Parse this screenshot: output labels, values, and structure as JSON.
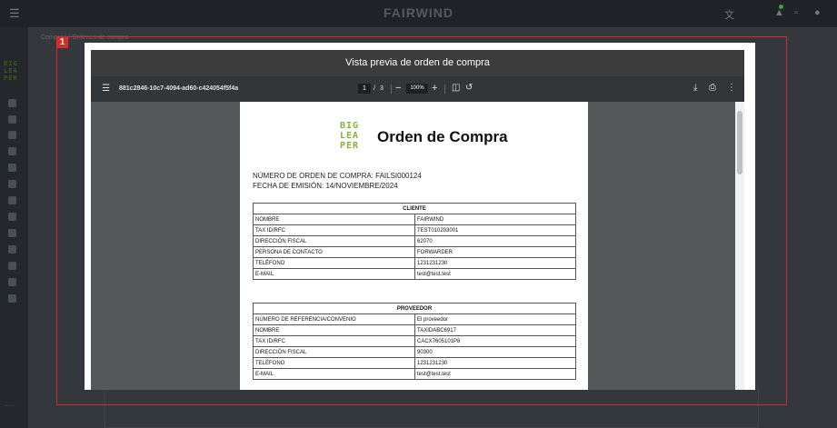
{
  "app": {
    "brand": "FAIRWIND",
    "breadcrumb": "Compras  /  Ordenes de compra"
  },
  "sidebar": {
    "logo": [
      "BIG",
      "LEA",
      "PER"
    ]
  },
  "highlight": {
    "label": "1"
  },
  "modal": {
    "title": "Vista previa de orden de compra"
  },
  "viewer": {
    "filename": "881c2846-10c7-4094-ad60-c424054f5f4a",
    "current_page": "1",
    "page_sep": "/",
    "total_pages": "3",
    "zoom": "100%",
    "icons": [
      "menu-icon",
      "zoom-out-icon",
      "zoom-in-icon",
      "fit-page-icon",
      "rotate-icon",
      "download-icon",
      "print-icon",
      "more-icon"
    ]
  },
  "document": {
    "logo": [
      "BIG",
      "LEA",
      "PER"
    ],
    "title": "Orden de Compra",
    "order_number_line": "NÚMERO DE ORDEN DE COMPRA: FAILSI000124",
    "issue_date_line": "FECHA DE EMISIÓN: 14/NOVIEMBRE/2024",
    "cliente": {
      "header": "CLIENTE",
      "rows": [
        {
          "k": "NOMBRE",
          "v": "FAIRWIND"
        },
        {
          "k": "TAX ID/RFC",
          "v": "TEST010203001"
        },
        {
          "k": "DIRECCIÓN FISCAL",
          "v": "62070"
        },
        {
          "k": "PERSONA DE CONTACTO",
          "v": "FORWARDER"
        },
        {
          "k": "TELÉFONO",
          "v": "1231231230"
        },
        {
          "k": "E-MAIL",
          "v": "test@test.test"
        }
      ]
    },
    "proveedor": {
      "header": "PROVEEDOR",
      "rows": [
        {
          "k": "NÚMERO DE REFERENCIA/CONVENIO",
          "v": "El proveedor"
        },
        {
          "k": "NOMBRE",
          "v": "TAXIDABC6917"
        },
        {
          "k": "TAX ID/RFC",
          "v": "CACX7605101P8"
        },
        {
          "k": "DIRECCIÓN FISCAL",
          "v": "90300"
        },
        {
          "k": "TELÉFONO",
          "v": "1231231230"
        },
        {
          "k": "E-MAIL",
          "v": "test@test.test"
        }
      ]
    }
  },
  "colors": {
    "highlight": "#d62b2b",
    "brand_green": "#86b23d",
    "viewer_toolbar": "#323639",
    "modal_header": "#3c3c3c"
  }
}
